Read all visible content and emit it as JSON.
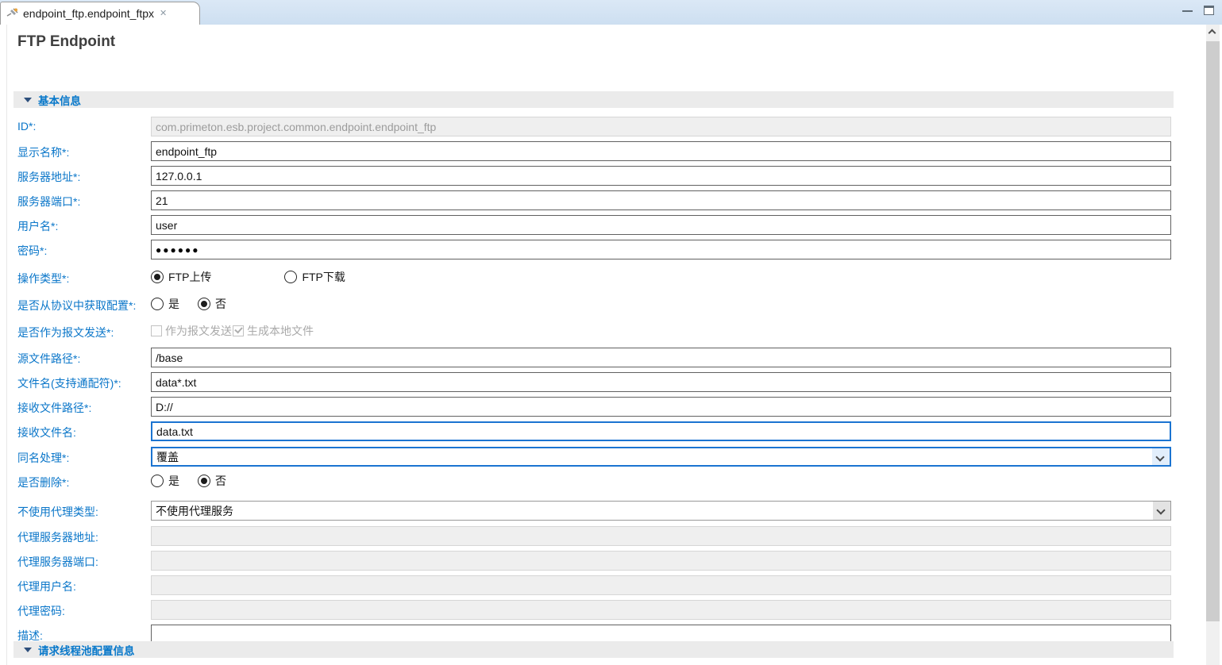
{
  "colors": {
    "label_blue": "#0a76c9",
    "focus_blue": "#1b74d1",
    "section_text": "#0878ca",
    "tabstrip": "#cddff1"
  },
  "tab": {
    "title": "endpoint_ftp.endpoint_ftpx",
    "close_glyph": "✕"
  },
  "page": {
    "title": "FTP Endpoint"
  },
  "sections": {
    "basic": "基本信息",
    "thread_pool": "请求线程池配置信息"
  },
  "form": {
    "id": {
      "label": "ID*:",
      "value": "com.primeton.esb.project.common.endpoint.endpoint_ftp"
    },
    "display_name": {
      "label": "显示名称*:",
      "value": "endpoint_ftp"
    },
    "server_addr": {
      "label": "服务器地址*:",
      "value": "127.0.0.1"
    },
    "server_port": {
      "label": "服务器端口*:",
      "value": "21"
    },
    "username": {
      "label": "用户名*:",
      "value": "user"
    },
    "password": {
      "label": "密码*:",
      "value": "●●●●●●"
    },
    "op_type": {
      "label": "操作类型*:",
      "options": [
        {
          "label": "FTP上传",
          "selected": true
        },
        {
          "label": "FTP下载",
          "selected": false
        }
      ]
    },
    "from_protocol": {
      "label": "是否从协议中获取配置*:",
      "options": [
        {
          "label": "是",
          "selected": false
        },
        {
          "label": "否",
          "selected": true
        }
      ]
    },
    "send_as_msg": {
      "label": "是否作为报文发送*:",
      "options": [
        {
          "label": "作为报文发送",
          "checked": false,
          "enabled": false
        },
        {
          "label": "生成本地文件",
          "checked": true,
          "enabled": false
        }
      ]
    },
    "src_path": {
      "label": "源文件路径*:",
      "value": "/base"
    },
    "file_name": {
      "label": "文件名(支持通配符)*:",
      "value": "data*.txt"
    },
    "recv_path": {
      "label": "接收文件路径*:",
      "value": "D://"
    },
    "recv_name": {
      "label": "接收文件名:",
      "value": "data.txt"
    },
    "same_name": {
      "label": "同名处理*:",
      "value": "覆盖"
    },
    "delete_flag": {
      "label": "是否删除*:",
      "options": [
        {
          "label": "是",
          "selected": false
        },
        {
          "label": "否",
          "selected": true
        }
      ]
    },
    "proxy_type": {
      "label": "不使用代理类型:",
      "value": "不使用代理服务"
    },
    "proxy_addr": {
      "label": "代理服务器地址:",
      "value": ""
    },
    "proxy_port": {
      "label": "代理服务器端口:",
      "value": ""
    },
    "proxy_user": {
      "label": "代理用户名:",
      "value": ""
    },
    "proxy_pass": {
      "label": "代理密码:",
      "value": ""
    },
    "description": {
      "label": "描述:",
      "value": ""
    }
  }
}
